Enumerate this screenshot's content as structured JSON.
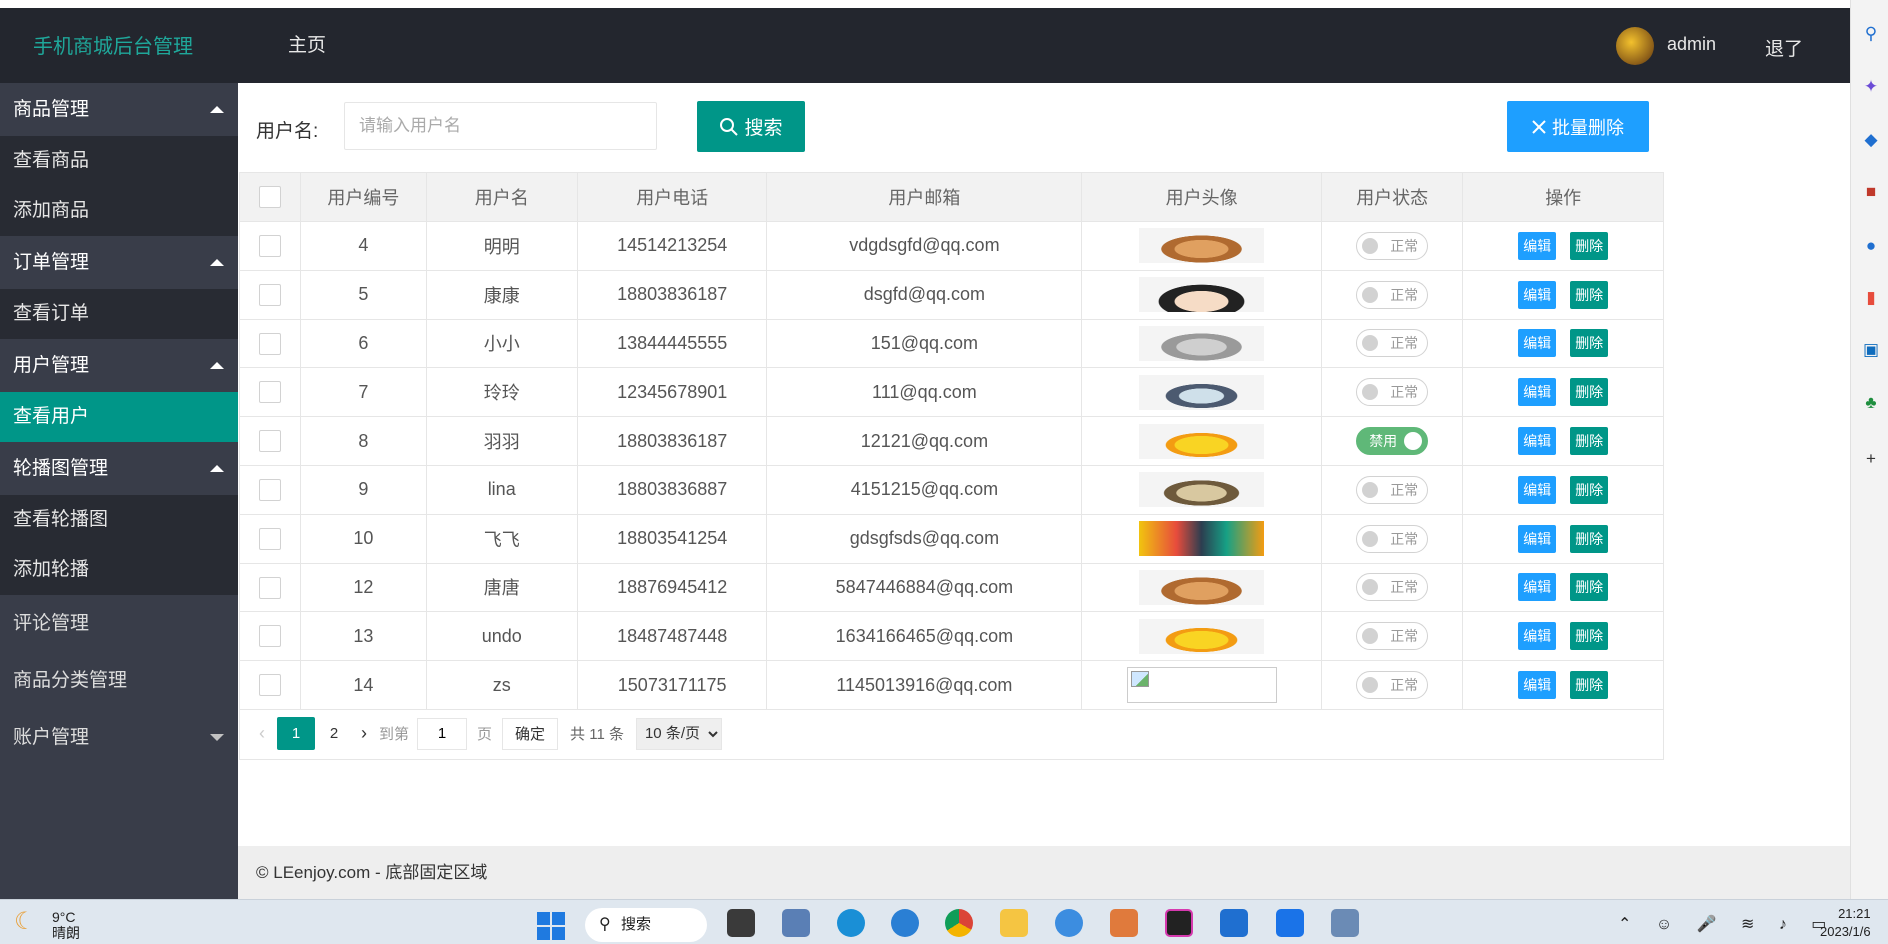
{
  "header": {
    "logo": "手机商城后台管理",
    "home": "主页",
    "username": "admin",
    "logout": "退了"
  },
  "sidebar": {
    "groups": [
      {
        "label": "商品管理",
        "items": [
          "查看商品",
          "添加商品"
        ]
      },
      {
        "label": "订单管理",
        "items": [
          "查看订单"
        ]
      },
      {
        "label": "用户管理",
        "items": [
          "查看用户"
        ]
      },
      {
        "label": "轮播图管理",
        "items": [
          "查看轮播图",
          "添加轮播"
        ]
      }
    ],
    "plain": [
      "评论管理",
      "商品分类管理",
      "账户管理"
    ],
    "active": "查看用户"
  },
  "toolbar": {
    "label": "用户名:",
    "placeholder": "请输入用户名",
    "search_label": "搜索",
    "batch_delete_label": "批量删除"
  },
  "table": {
    "headers": [
      "用户编号",
      "用户名",
      "用户电话",
      "用户邮箱",
      "用户头像",
      "用户状态",
      "操作"
    ],
    "edit_label": "编辑",
    "delete_label": "删除",
    "rows": [
      {
        "id": "4",
        "name": "明明",
        "phone": "14514213254",
        "email": "vdgdsgfd@qq.com",
        "avatar": "dog",
        "status": "正常"
      },
      {
        "id": "5",
        "name": "康康",
        "phone": "18803836187",
        "email": "dsgfd@qq.com",
        "avatar": "boy",
        "status": "正常"
      },
      {
        "id": "6",
        "name": "小小",
        "phone": "13844445555",
        "email": "151@qq.com",
        "avatar": "koala",
        "status": "正常"
      },
      {
        "id": "7",
        "name": "玲玲",
        "phone": "12345678901",
        "email": "111@qq.com",
        "avatar": "cat",
        "status": "正常"
      },
      {
        "id": "8",
        "name": "羽羽",
        "phone": "18803836187",
        "email": "12121@qq.com",
        "avatar": "chick",
        "status": "禁用"
      },
      {
        "id": "9",
        "name": "lina",
        "phone": "18803836887",
        "email": "4151215@qq.com",
        "avatar": "owl",
        "status": "正常"
      },
      {
        "id": "10",
        "name": "飞飞",
        "phone": "18803541254",
        "email": "gdsgfsds@qq.com",
        "avatar": "colorful",
        "status": "正常"
      },
      {
        "id": "12",
        "name": "唐唐",
        "phone": "18876945412",
        "email": "5847446884@qq.com",
        "avatar": "dog",
        "status": "正常"
      },
      {
        "id": "13",
        "name": "undo",
        "phone": "18487487448",
        "email": "1634166465@qq.com",
        "avatar": "chick",
        "status": "正常"
      },
      {
        "id": "14",
        "name": "zs",
        "phone": "15073171175",
        "email": "1145013916@qq.com",
        "avatar": "broken",
        "status": "正常"
      }
    ]
  },
  "pager": {
    "pages": [
      "1",
      "2"
    ],
    "current": "1",
    "goto_text": "到第",
    "goto_value": "1",
    "page_text": "页",
    "confirm": "确定",
    "total": "共 11 条",
    "limit": "10 条/页"
  },
  "footer": "© LEenjoy.com - 底部固定区域",
  "taskbar": {
    "temp": "9°C",
    "weather": "晴朗",
    "search": "搜索",
    "time": "21:21",
    "date": "2023/1/6"
  }
}
